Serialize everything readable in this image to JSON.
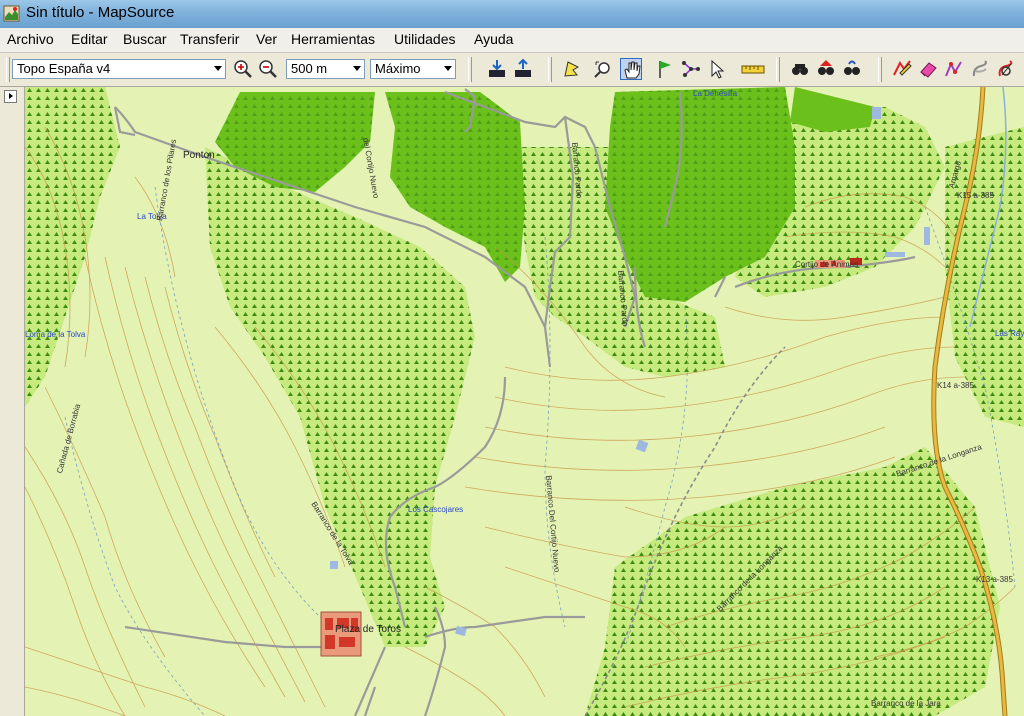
{
  "window": {
    "title": "Sin título - MapSource",
    "app_icon": "mapsource-app-icon"
  },
  "menu": [
    "Archivo",
    "Editar",
    "Buscar",
    "Transferir",
    "Ver",
    "Herramientas",
    "Utilidades",
    "Ayuda"
  ],
  "toolbar": {
    "map_product": "Topo España v4",
    "zoom_scale": "500 m",
    "detail_level": "Máximo",
    "icons": [
      "zoom-in-icon",
      "zoom-out-icon",
      "receive-from-device-icon",
      "send-to-device-icon",
      "selection-tool-icon",
      "zoom-tool-icon",
      "hand-tool-icon",
      "waypoint-flag-icon",
      "route-tool-icon",
      "pointer-icon",
      "distance-tool-icon",
      "find-icon",
      "find-address-icon",
      "find-nearby-icon",
      "edit-track-icon",
      "erase-icon",
      "connect-tracks-icon",
      "divide-track-icon",
      "hide-track-icon"
    ]
  },
  "colors": {
    "map_background": "#e4f3b4",
    "forest_dark": "#6cc01c",
    "forest_light": "#c6ea7e",
    "contour": "#c99a4c",
    "road_main": "#d4a12a",
    "track": "#9a9a9a",
    "label_blue": "#2a47c9"
  },
  "map": {
    "labels": {
      "ponton": "Ponton",
      "la_tolva": "La Tolva",
      "loma_tolva": "Loma de la Tolva",
      "barranco_pilares": "Barranco de los Pilares",
      "cortijo_nuevo": "del Cortijo Nuevo",
      "barranco_pardo": "Barranco Pardo",
      "barranco_pardo2": "Barranco Pardo",
      "la_dehesilla": "La Dehesilla",
      "cortijo_animas": "Cortijo de Ánimas",
      "km15": "K15 a-385",
      "km14": "K14 a-385",
      "km13": "K13 a-385",
      "amarga": "Amargo",
      "las_rayas": "Las Raya",
      "los_cascojares": "Los Cascojares",
      "barranco_cortijo_nuevo": "Barranco Del Cortijo Nuevo",
      "barranco_longanza": "Barranco de la Longanza",
      "barranco_longanza2": "Barranco de la Longanza",
      "barranco_jara": "Barranco de la Jara",
      "cerro_nobrana": "Cañada de Borrabia",
      "barranco_tolva": "Barranco de la Tolva",
      "plaza_toros": "Plaza de Toros"
    }
  }
}
